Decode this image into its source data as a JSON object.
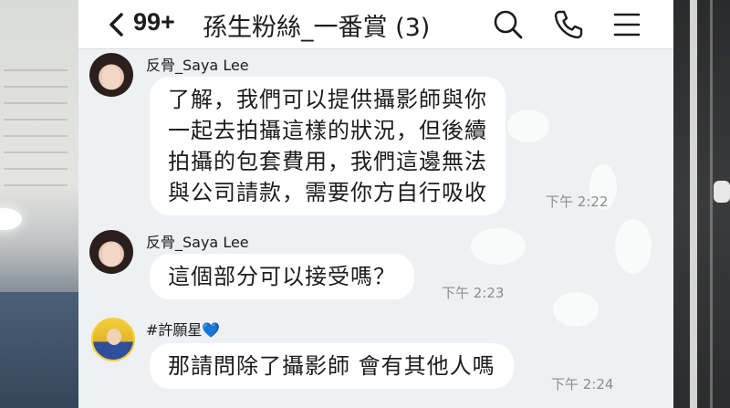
{
  "header": {
    "back_count": "99+",
    "chat_title": "孫生粉絲_一番賞 (3)"
  },
  "messages": [
    {
      "sender": "反骨_Saya Lee",
      "lines": [
        "了解，我們可以提供攝影師與你",
        "一起去拍攝這樣的狀況，但後續",
        "拍攝的包套費用，我們這邊無法",
        "與公司請款，需要你方自行吸收"
      ],
      "time": "下午 2:22"
    },
    {
      "sender": "反骨_Saya Lee",
      "lines": [
        "這個部分可以接受嗎？"
      ],
      "time": "下午 2:23"
    },
    {
      "sender": "#許願星💙",
      "lines": [
        "那請問除了攝影師 會有其他人嗎"
      ],
      "time": "下午 2:24"
    }
  ],
  "colors": {
    "background": "#eef0f2",
    "bubble": "#ffffff",
    "text": "#1b1c1e",
    "time": "#8a8d90"
  },
  "icons": [
    "chevron-left-icon",
    "search-icon",
    "phone-icon",
    "menu-icon"
  ]
}
